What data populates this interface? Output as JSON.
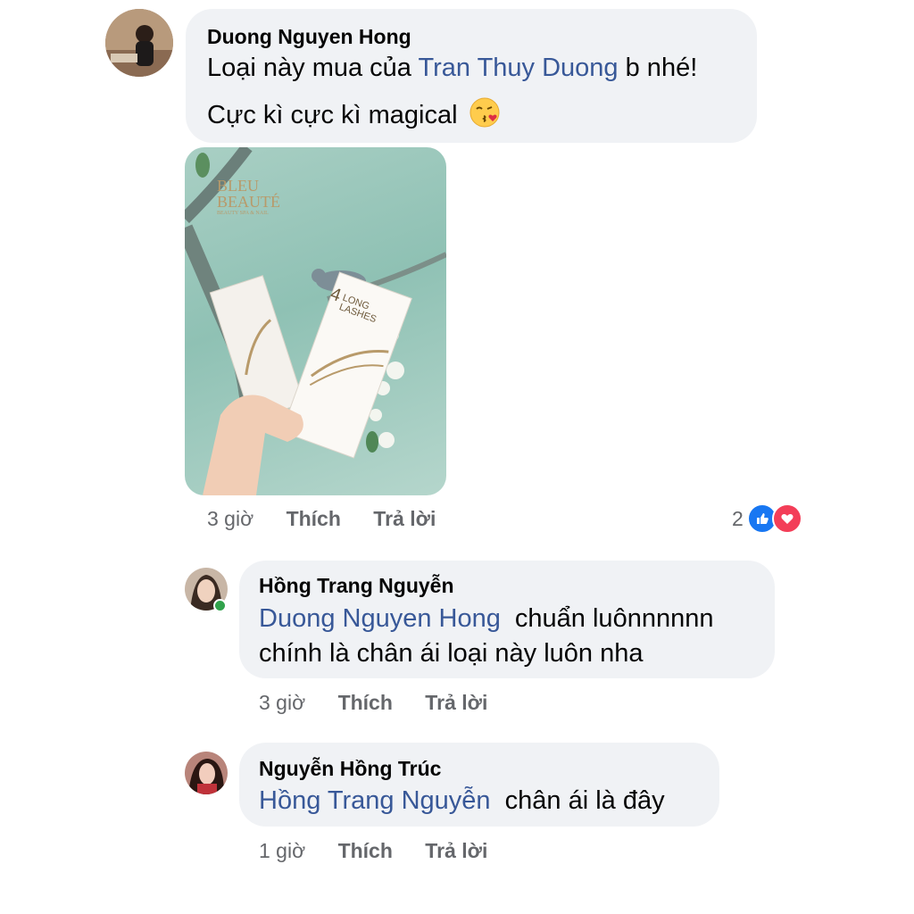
{
  "comments": [
    {
      "author": "Duong Nguyen Hong",
      "line1_text": "Loại này mua của",
      "line1_mention": "Tran Thuy Duong",
      "line1_suffix": "b nhé!",
      "line2_text": "Cực kì cực kì magical",
      "line2_emoji": "😘",
      "time": "3 giờ",
      "like_label": "Thích",
      "reply_label": "Trả lời",
      "reaction_count": "2",
      "photo": {
        "brand_line1": "BLEU",
        "brand_line2": "BEAUTÉ",
        "brand_tagline": "BEAUTY SPA & NAIL",
        "product_line1": "LONG",
        "product_line2": "LASHES",
        "product_number": "4"
      }
    },
    {
      "author": "Hồng Trang Nguyễn",
      "line1_mention": "Duong Nguyen Hong",
      "line1_text": "chuẩn luônnnnnn",
      "line2_text": "chính là chân ái loại này luôn nha",
      "time": "3 giờ",
      "like_label": "Thích",
      "reply_label": "Trả lời"
    },
    {
      "author": "Nguyễn Hồng Trúc",
      "line1_mention": "Hồng Trang Nguyễn",
      "line1_text": "chân ái là đây",
      "time": "1 giờ",
      "like_label": "Thích",
      "reply_label": "Trả lời"
    }
  ],
  "colors": {
    "bubble": "#f0f2f5",
    "mention": "#385898",
    "meta": "#65676b",
    "like": "#1877f2",
    "love": "#f33e58",
    "online": "#31a24c"
  },
  "icons": [
    "like-reaction-icon",
    "love-reaction-icon",
    "kiss-emoji-icon"
  ]
}
